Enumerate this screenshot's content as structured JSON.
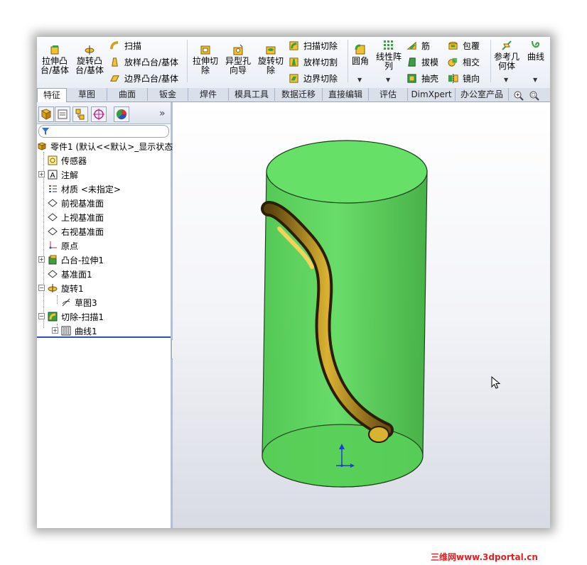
{
  "toolbar": {
    "extrude_boss": "拉伸凸\n台/基体",
    "revolve_boss": "旋转凸\n台/基体",
    "sweep": "扫描",
    "loft_boss": "放样凸台/基体",
    "boundary_boss": "边界凸台/基体",
    "extrude_cut": "拉伸切\n除",
    "hole_wizard": "异型孔\n向导",
    "revolve_cut": "旋转切\n除",
    "sweep_cut": "扫描切除",
    "loft_cut": "放样切割",
    "boundary_cut": "边界切除",
    "fillet": "圆角",
    "linear_pattern": "线性阵\n列",
    "rib": "筋",
    "draft": "拔模",
    "shell": "抽壳",
    "wrap": "包覆",
    "intersect": "相交",
    "mirror": "镜向",
    "ref_geometry": "参考几\n何体",
    "curves": "曲线"
  },
  "tabs": [
    "特征",
    "草图",
    "曲面",
    "钣金",
    "焊件",
    "模具工具",
    "数据迁移",
    "直接编辑",
    "评估",
    "DimXpert",
    "办公室产品"
  ],
  "active_tab": "特征",
  "feature_tree": {
    "root": "零件1 (默认<<默认>_显示状态",
    "items": [
      {
        "label": "传感器",
        "icon": "sensor-icon"
      },
      {
        "label": "注解",
        "icon": "annotation-icon"
      },
      {
        "label": "材质 <未指定>",
        "icon": "material-icon"
      },
      {
        "label": "前视基准面",
        "icon": "plane-icon"
      },
      {
        "label": "上视基准面",
        "icon": "plane-icon"
      },
      {
        "label": "右视基准面",
        "icon": "plane-icon"
      },
      {
        "label": "原点",
        "icon": "origin-icon"
      },
      {
        "label": "凸台-拉伸1",
        "icon": "extrude-icon"
      },
      {
        "label": "基准面1",
        "icon": "plane-icon"
      },
      {
        "label": "旋转1",
        "icon": "revolve-icon"
      },
      {
        "label": "草图3",
        "icon": "sketch-icon"
      },
      {
        "label": "切除-扫描1",
        "icon": "sweep-cut-icon"
      },
      {
        "label": "曲线1",
        "icon": "curve-icon"
      }
    ]
  },
  "panel_expand_glyph": "»",
  "watermark": "三维网www.3dportal.cn",
  "colors": {
    "cylinder_fill": "#55d455",
    "cylinder_edge": "#1a3a1a",
    "groove_gold": "#d9b232",
    "groove_dark": "#6b4e10",
    "tree_selection_line": "#3050c0"
  }
}
